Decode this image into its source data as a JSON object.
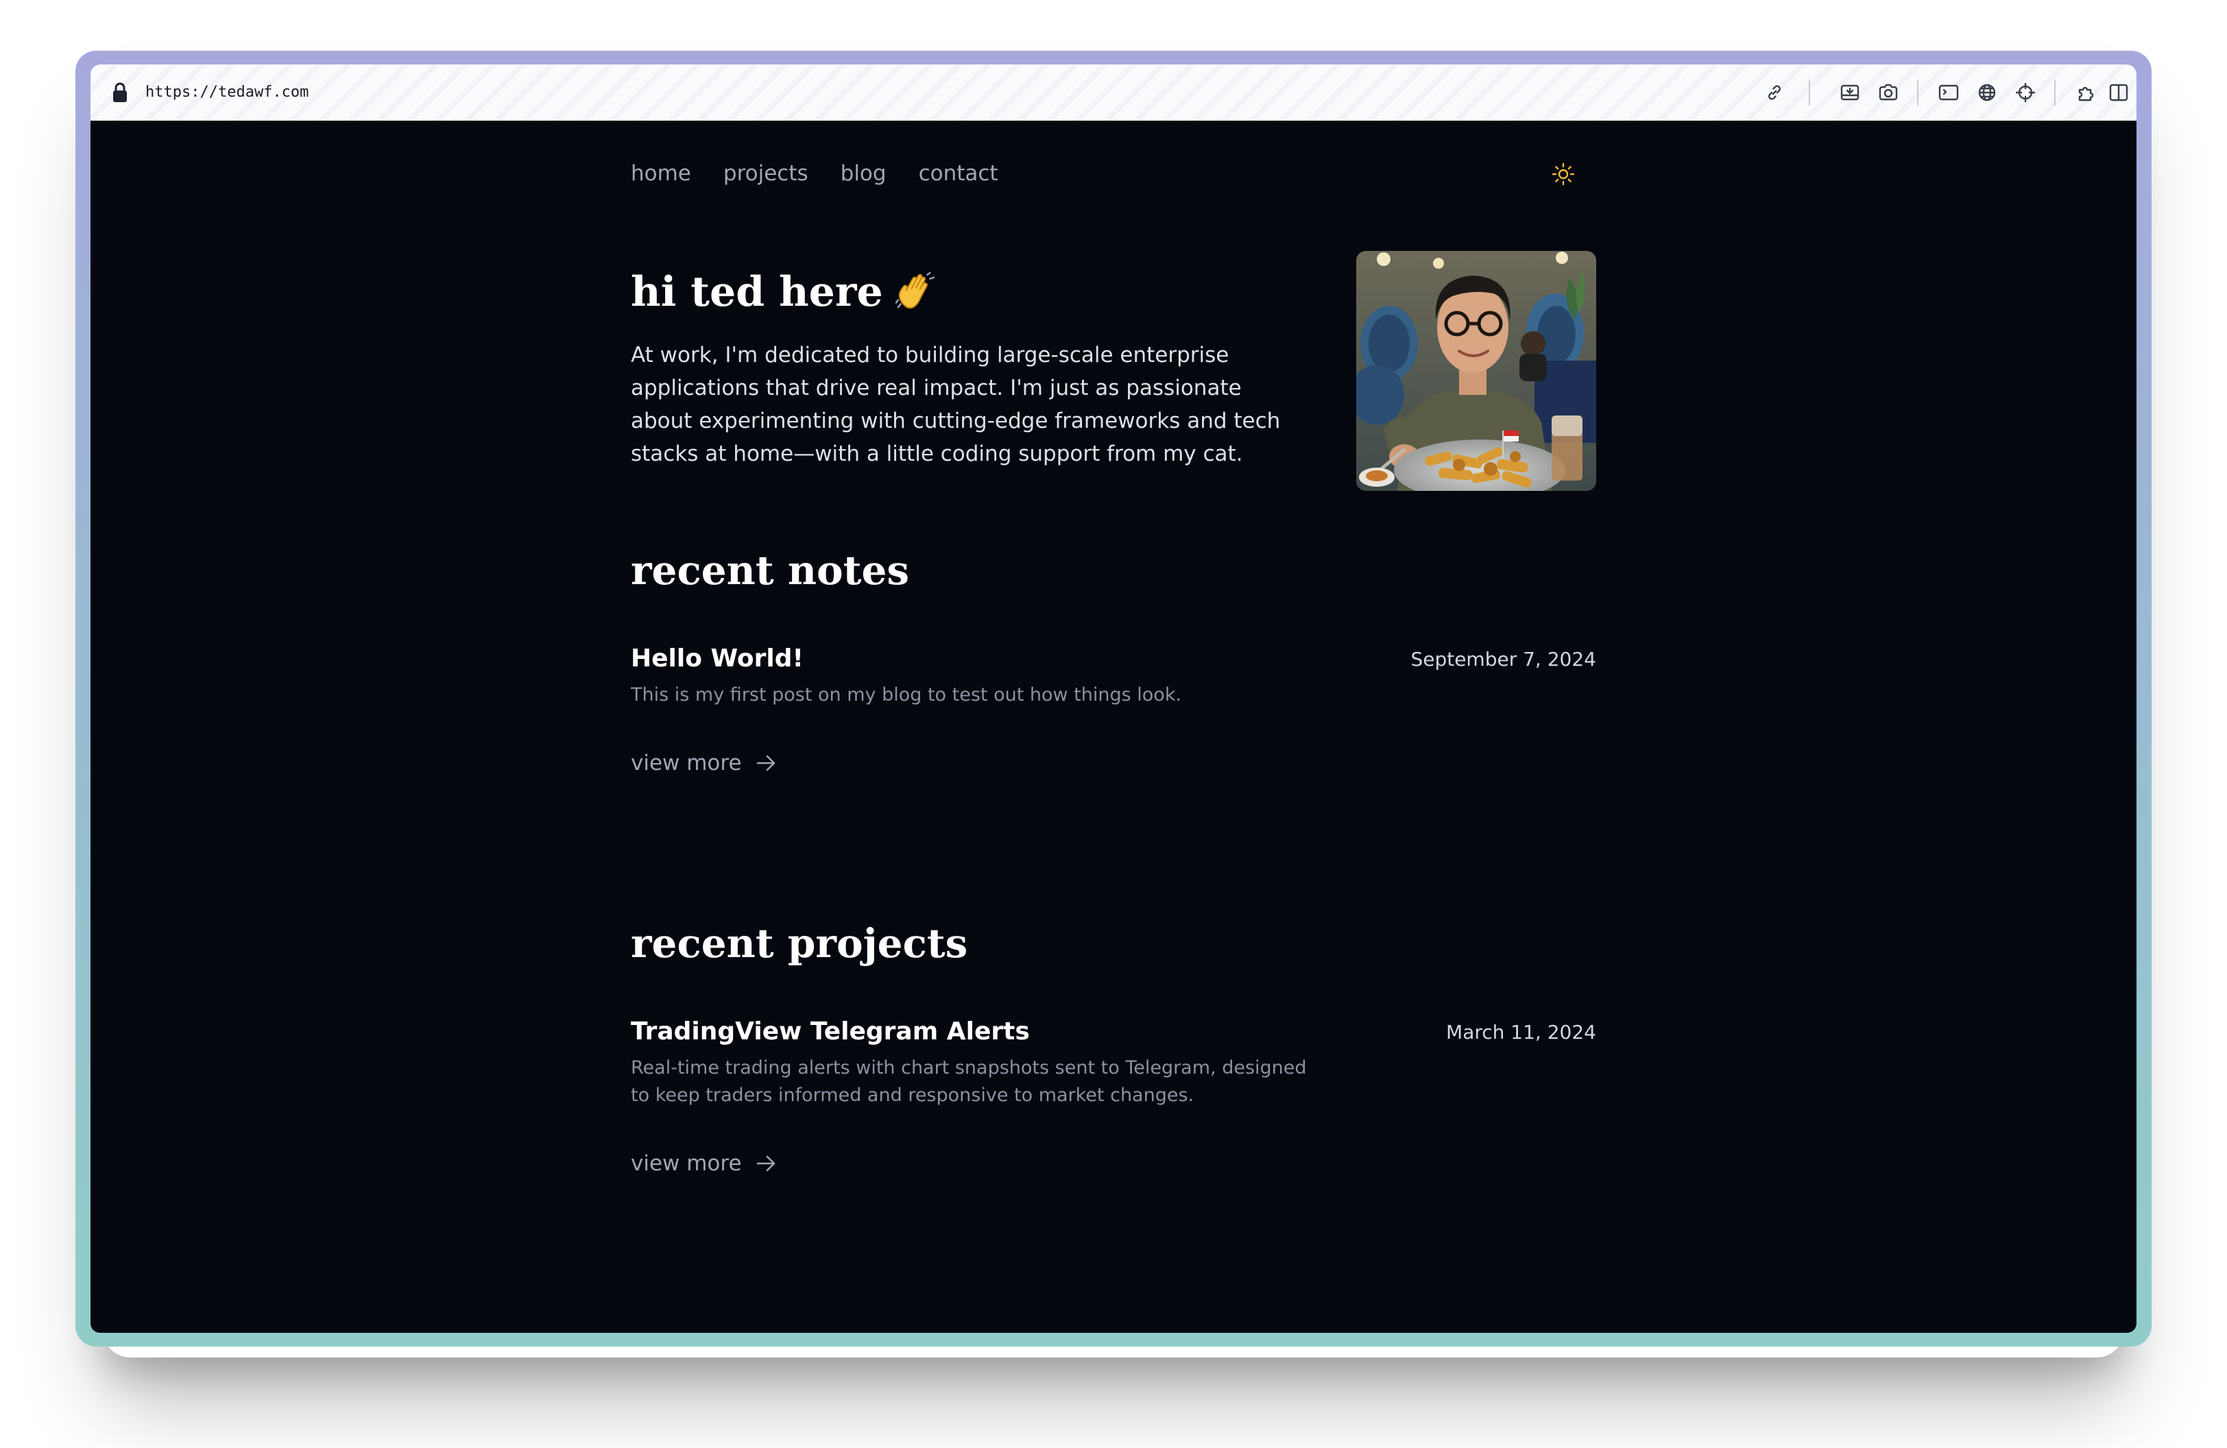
{
  "browser": {
    "url": "https://tedawf.com"
  },
  "toolbar_icons": [
    "link-icon",
    "download-icon",
    "camera-icon",
    "terminal-icon",
    "globe-icon",
    "crosshair-icon",
    "extension-icon",
    "sidebar-icon"
  ],
  "nav": {
    "items": [
      {
        "label": "home"
      },
      {
        "label": "projects"
      },
      {
        "label": "blog"
      },
      {
        "label": "contact"
      }
    ],
    "theme_toggle_icon": "sun-icon"
  },
  "hero": {
    "title": "hi ted here",
    "emoji": "👋",
    "description": "At work, I'm dedicated to building large-scale enterprise applications that drive real impact. I'm just as passionate about experimenting with cutting-edge frameworks and tech stacks at home—with a little coding support from my cat."
  },
  "recent_notes": {
    "heading": "recent notes",
    "items": [
      {
        "title": "Hello World!",
        "date": "September 7, 2024",
        "description": "This is my first post on my blog to test out how things look."
      }
    ],
    "view_more": "view more"
  },
  "recent_projects": {
    "heading": "recent projects",
    "items": [
      {
        "title": "TradingView Telegram Alerts",
        "date": "March 11, 2024",
        "description": "Real-time trading alerts with chart snapshots sent to Telegram, designed to keep traders informed and responsive to market changes."
      }
    ],
    "view_more": "view more"
  },
  "colors": {
    "page_background": "#05070f",
    "nav_text": "#a2a6b3",
    "heading_text": "#ffffff",
    "muted_text": "#8c91a0",
    "sun_accent": "#f5b638"
  }
}
